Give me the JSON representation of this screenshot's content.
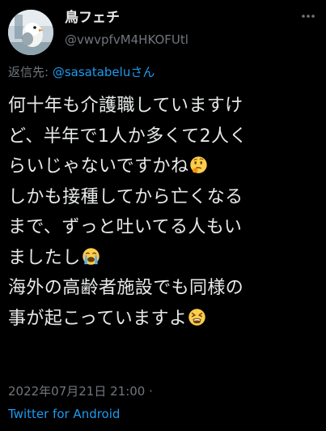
{
  "user": {
    "display_name": "鳥フェチ",
    "handle": "@vwvpfvM4HKOFUtl"
  },
  "reply": {
    "prefix": "返信先: ",
    "mention": "@sasatabelu",
    "suffix": "さん"
  },
  "tweet": {
    "lines": [
      "何十年も介護職していますけ",
      "ど、半年で1人か多くて2人く",
      "らいじゃないですかね",
      "しかも接種してから亡くなる",
      "まで、ずっと吐いてる人もい",
      "ましたし",
      "海外の高齢者施設でも同様の",
      "事が起こっていますよ"
    ],
    "emojis": {
      "line_3": "thinking-face",
      "line_6": "loudly-crying-face",
      "line_8": "tired-face"
    }
  },
  "meta": {
    "timestamp": "2022年07月21日 21:00",
    "separator": " ·",
    "source": "Twitter for Android"
  },
  "colors": {
    "background": "#000000",
    "text_primary": "#e7e9ea",
    "text_secondary": "#71767b",
    "link": "#1d9bf0"
  }
}
